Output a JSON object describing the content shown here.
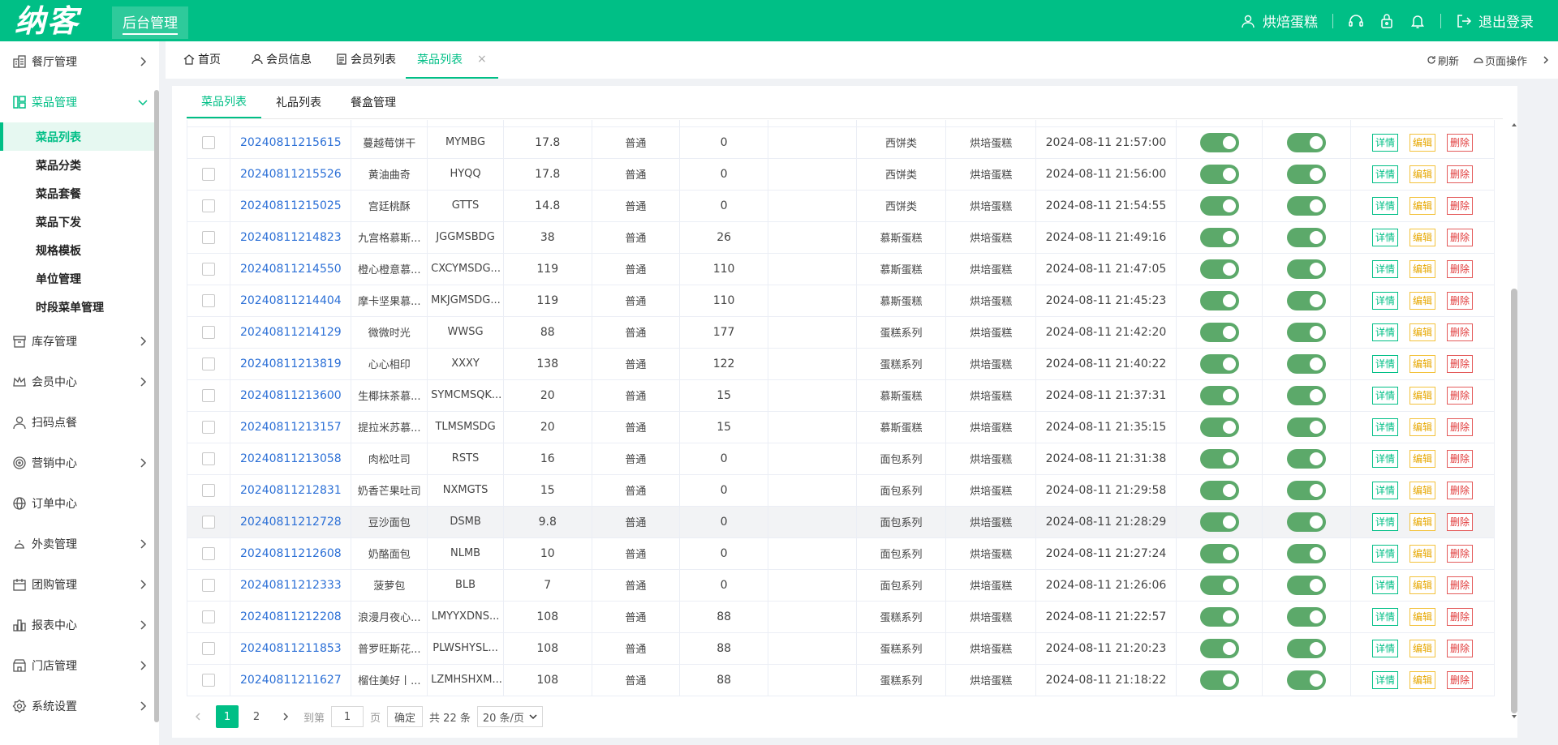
{
  "brand": {
    "logo": "纳客",
    "admin_tab": "后台管理"
  },
  "header": {
    "username": "烘焙蛋糕",
    "logout": "退出登录",
    "icons": [
      "user-icon",
      "headset-icon",
      "lock-icon",
      "bell-icon",
      "logout-icon"
    ]
  },
  "sidebar": {
    "items": [
      {
        "label": "餐厅管理",
        "icon": "restaurant-icon"
      },
      {
        "label": "菜品管理",
        "icon": "dish-icon"
      },
      {
        "label": "库存管理",
        "icon": "inventory-icon"
      },
      {
        "label": "会员中心",
        "icon": "crown-icon"
      },
      {
        "label": "扫码点餐",
        "icon": "person-icon"
      },
      {
        "label": "营销中心",
        "icon": "target-icon"
      },
      {
        "label": "订单中心",
        "icon": "globe-icon"
      },
      {
        "label": "外卖管理",
        "icon": "delivery-icon"
      },
      {
        "label": "团购管理",
        "icon": "calendar-icon"
      },
      {
        "label": "报表中心",
        "icon": "chart-icon"
      },
      {
        "label": "门店管理",
        "icon": "store-icon"
      },
      {
        "label": "系统设置",
        "icon": "gear-icon"
      }
    ],
    "sub_items": [
      "菜品列表",
      "菜品分类",
      "菜品套餐",
      "菜品下发",
      "规格模板",
      "单位管理",
      "时段菜单管理"
    ]
  },
  "tabs": {
    "items": [
      "首页",
      "会员信息",
      "会员列表",
      "菜品列表"
    ],
    "close": "×",
    "refresh": "刷新",
    "page_ops": "页面操作"
  },
  "subtabs": [
    "菜品列表",
    "礼品列表",
    "餐盒管理"
  ],
  "table": {
    "actions": {
      "detail": "详情",
      "edit": "编辑",
      "delete": "删除"
    },
    "rows": [
      {
        "code": "20240811215615",
        "name": "蔓越莓饼干",
        "abbr": "MYMBG",
        "price": "17.8",
        "type": "普通",
        "qty": "0",
        "extra": "",
        "category": "西饼类",
        "store": "烘培蛋糕",
        "time": "2024-08-11 21:57:00"
      },
      {
        "code": "20240811215526",
        "name": "黄油曲奇",
        "abbr": "HYQQ",
        "price": "17.8",
        "type": "普通",
        "qty": "0",
        "extra": "",
        "category": "西饼类",
        "store": "烘培蛋糕",
        "time": "2024-08-11 21:56:00"
      },
      {
        "code": "20240811215025",
        "name": "宫廷桃酥",
        "abbr": "GTTS",
        "price": "14.8",
        "type": "普通",
        "qty": "0",
        "extra": "",
        "category": "西饼类",
        "store": "烘培蛋糕",
        "time": "2024-08-11 21:54:55"
      },
      {
        "code": "20240811214823",
        "name": "九宫格慕斯...",
        "abbr": "JGGMSBDG",
        "price": "38",
        "type": "普通",
        "qty": "26",
        "extra": "",
        "category": "慕斯蛋糕",
        "store": "烘培蛋糕",
        "time": "2024-08-11 21:49:16"
      },
      {
        "code": "20240811214550",
        "name": "橙心橙意慕...",
        "abbr": "CXCYMSDG...",
        "price": "119",
        "type": "普通",
        "qty": "110",
        "extra": "",
        "category": "慕斯蛋糕",
        "store": "烘培蛋糕",
        "time": "2024-08-11 21:47:05"
      },
      {
        "code": "20240811214404",
        "name": "摩卡坚果慕...",
        "abbr": "MKJGMSDG...",
        "price": "119",
        "type": "普通",
        "qty": "110",
        "extra": "",
        "category": "慕斯蛋糕",
        "store": "烘培蛋糕",
        "time": "2024-08-11 21:45:23"
      },
      {
        "code": "20240811214129",
        "name": "微微时光",
        "abbr": "WWSG",
        "price": "88",
        "type": "普通",
        "qty": "177",
        "extra": "",
        "category": "蛋糕系列",
        "store": "烘培蛋糕",
        "time": "2024-08-11 21:42:20"
      },
      {
        "code": "20240811213819",
        "name": "心心相印",
        "abbr": "XXXY",
        "price": "138",
        "type": "普通",
        "qty": "122",
        "extra": "",
        "category": "蛋糕系列",
        "store": "烘培蛋糕",
        "time": "2024-08-11 21:40:22"
      },
      {
        "code": "20240811213600",
        "name": "生椰抹茶慕...",
        "abbr": "SYMCMSQK...",
        "price": "20",
        "type": "普通",
        "qty": "15",
        "extra": "",
        "category": "慕斯蛋糕",
        "store": "烘培蛋糕",
        "time": "2024-08-11 21:37:31"
      },
      {
        "code": "20240811213157",
        "name": "提拉米苏慕...",
        "abbr": "TLMSMSDG",
        "price": "20",
        "type": "普通",
        "qty": "15",
        "extra": "",
        "category": "慕斯蛋糕",
        "store": "烘培蛋糕",
        "time": "2024-08-11 21:35:15"
      },
      {
        "code": "20240811213058",
        "name": "肉松吐司",
        "abbr": "RSTS",
        "price": "16",
        "type": "普通",
        "qty": "0",
        "extra": "",
        "category": "面包系列",
        "store": "烘培蛋糕",
        "time": "2024-08-11 21:31:38"
      },
      {
        "code": "20240811212831",
        "name": "奶香芒果吐司",
        "abbr": "NXMGTS",
        "price": "15",
        "type": "普通",
        "qty": "0",
        "extra": "",
        "category": "面包系列",
        "store": "烘培蛋糕",
        "time": "2024-08-11 21:29:58"
      },
      {
        "code": "20240811212728",
        "name": "豆沙面包",
        "abbr": "DSMB",
        "price": "9.8",
        "type": "普通",
        "qty": "0",
        "extra": "",
        "category": "面包系列",
        "store": "烘培蛋糕",
        "time": "2024-08-11 21:28:29"
      },
      {
        "code": "20240811212608",
        "name": "奶酪面包",
        "abbr": "NLMB",
        "price": "10",
        "type": "普通",
        "qty": "0",
        "extra": "",
        "category": "面包系列",
        "store": "烘培蛋糕",
        "time": "2024-08-11 21:27:24"
      },
      {
        "code": "20240811212333",
        "name": "菠萝包",
        "abbr": "BLB",
        "price": "7",
        "type": "普通",
        "qty": "0",
        "extra": "",
        "category": "面包系列",
        "store": "烘培蛋糕",
        "time": "2024-08-11 21:26:06"
      },
      {
        "code": "20240811212208",
        "name": "浪漫月夜心...",
        "abbr": "LMYYXDNS...",
        "price": "108",
        "type": "普通",
        "qty": "88",
        "extra": "",
        "category": "蛋糕系列",
        "store": "烘培蛋糕",
        "time": "2024-08-11 21:22:57"
      },
      {
        "code": "20240811211853",
        "name": "普罗旺斯花...",
        "abbr": "PLWSHYSL...",
        "price": "108",
        "type": "普通",
        "qty": "88",
        "extra": "",
        "category": "蛋糕系列",
        "store": "烘培蛋糕",
        "time": "2024-08-11 21:20:23"
      },
      {
        "code": "20240811211627",
        "name": "榴住美好丨...",
        "abbr": "LZMHSHXM...",
        "price": "108",
        "type": "普通",
        "qty": "88",
        "extra": "",
        "category": "蛋糕系列",
        "store": "烘培蛋糕",
        "time": "2024-08-11 21:18:22"
      }
    ]
  },
  "pager": {
    "pages": [
      "1",
      "2"
    ],
    "current": "1",
    "goto_label": "到第",
    "goto_value": "1",
    "page_unit": "页",
    "confirm": "确定",
    "total": "共 22 条",
    "page_size": "20 条/页"
  },
  "colors": {
    "brand": "#00bf86",
    "link": "#2b6fd6",
    "toggle_on": "#5ca96a",
    "edit": "#f3c23c",
    "delete": "#e45b5b"
  }
}
